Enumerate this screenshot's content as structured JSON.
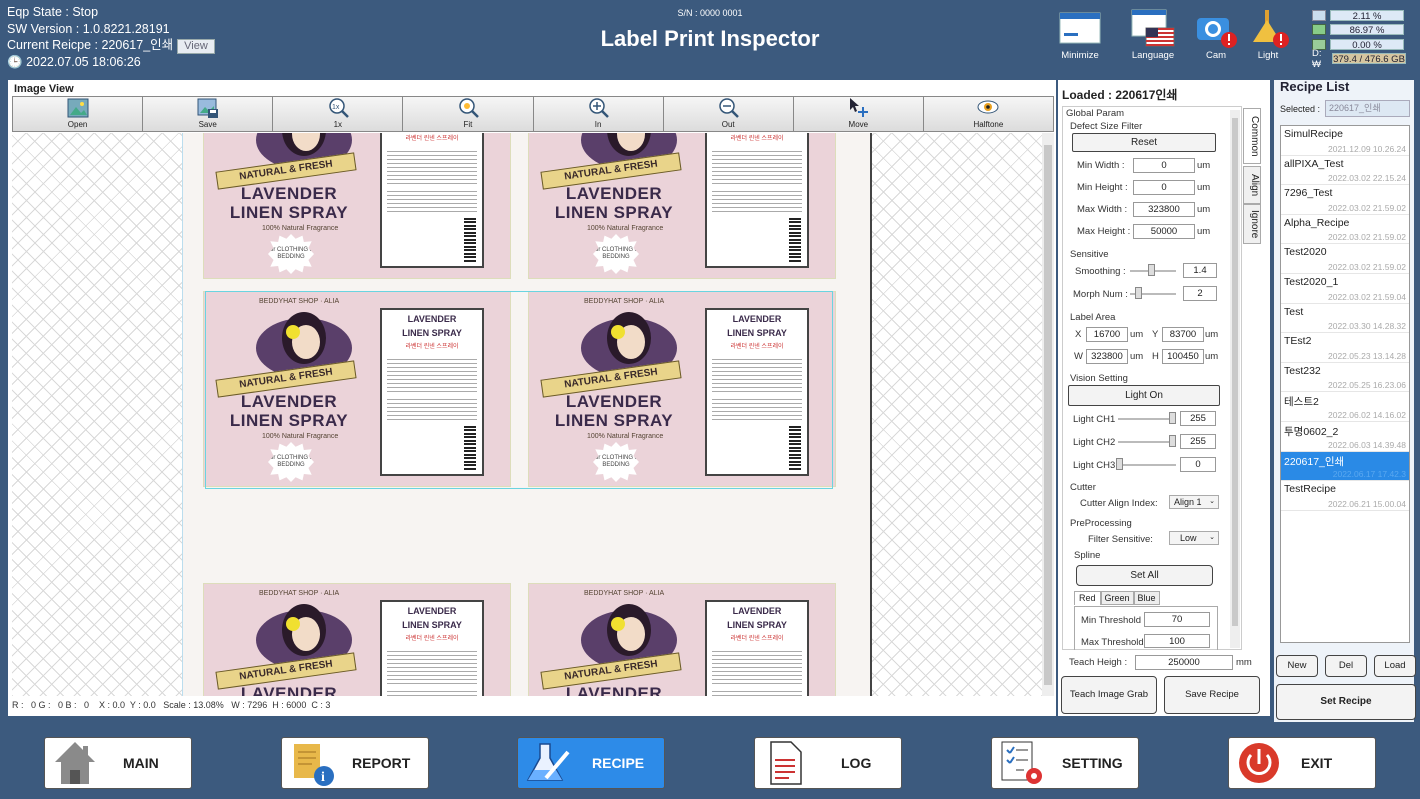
{
  "header": {
    "eqp_state": "Eqp State : Stop",
    "sw_version": "SW Version : 1.0.8221.28191",
    "current_recipe": "Current Reicpe : 220617_인쇄",
    "view_label": "View",
    "datetime": "2022.07.05 18:06:26",
    "serial": "S/N : 0000 0001",
    "title": "Label Print Inspector",
    "icons": {
      "minimize": "Minimize",
      "language": "Language",
      "cam": "Cam",
      "light": "Light"
    },
    "disk": {
      "cpu": "2.11 %",
      "mem": "86.97 %",
      "net": "0.00 %",
      "drive_label": "D:₩",
      "drive": "379.4 / 476.6 GB"
    }
  },
  "image_view": {
    "title": "Image View",
    "tools": [
      "Open",
      "Save",
      "1x",
      "Fit",
      "In",
      "Out",
      "Move",
      "Halftone"
    ],
    "status": "R :   0 G :   0 B :   0    X : 0.0  Y : 0.0   Scale : 13.08%   W : 7296  H : 6000  C : 3",
    "label": {
      "name1": "LAVENDER",
      "name2": "LINEN SPRAY",
      "ribbon": "NATURAL & FRESH",
      "tag": "100% Natural Fragrance",
      "badge": "for CLOTHING & BEDDING",
      "brand": "BEDDYHAT SHOP · ALIA",
      "panel_title1": "LAVENDER",
      "panel_title2": "LINEN SPRAY",
      "panel_sub": "라벤더 린넨 스프레이"
    }
  },
  "params": {
    "loaded": "Loaded : 220617인쇄",
    "global": "Global Param",
    "defect": "Defect Size Filter",
    "reset": "Reset",
    "min_width_l": "Min Width :",
    "min_width": "0",
    "min_height_l": "Min Height :",
    "min_height": "0",
    "max_width_l": "Max Width :",
    "max_width": "323800",
    "max_height_l": "Max Height :",
    "max_height": "50000",
    "um": "um",
    "sensitive": "Sensitive",
    "smoothing_l": "Smoothing :",
    "smoothing": "1.4",
    "morph_l": "Morph Num :",
    "morph": "2",
    "label_area": "Label Area",
    "x_l": "X",
    "x": "16700",
    "y_l": "Y",
    "y": "83700",
    "w_l": "W",
    "w": "323800",
    "h_l": "H",
    "h": "100450",
    "vision": "Vision Setting",
    "light_on": "Light On",
    "ch1_l": "Light CH1",
    "ch1": "255",
    "ch2_l": "Light CH2",
    "ch2": "255",
    "ch3_l": "Light CH3",
    "ch3": "0",
    "cutter": "Cutter",
    "cutter_idx_l": "Cutter Align Index:",
    "cutter_idx": "Align 1",
    "preproc": "PreProcessing",
    "filter_l": "Filter Sensitive:",
    "filter": "Low",
    "spline": "Spline",
    "set_all": "Set All",
    "tabs": [
      "Red",
      "Green",
      "Blue"
    ],
    "min_th_l": "Min Threshold",
    "min_th": "70",
    "max_th_l": "Max Threshold",
    "max_th": "100",
    "teach_l": "Teach Heigh :",
    "teach": "250000",
    "mm": "mm",
    "teach_grab": "Teach Image Grab",
    "save_recipe": "Save Recipe",
    "side_tabs": [
      "Common",
      "Align",
      "Ignore"
    ]
  },
  "recipes": {
    "title": "Recipe List",
    "selected_l": "Selected :",
    "selected": "220617_인쇄",
    "items": [
      {
        "name": "SimulRecipe",
        "date": "2021.12.09 10.26.24"
      },
      {
        "name": "allPIXA_Test",
        "date": "2022.03.02 22.15.24"
      },
      {
        "name": "7296_Test",
        "date": "2022.03.02 21.59.02"
      },
      {
        "name": "Alpha_Recipe",
        "date": "2022.03.02 21.59.02"
      },
      {
        "name": "Test2020",
        "date": "2022.03.02 21.59.02"
      },
      {
        "name": "Test2020_1",
        "date": "2022.03.02 21.59.04"
      },
      {
        "name": "Test",
        "date": "2022.03.30 14.28.32"
      },
      {
        "name": "TEst2",
        "date": "2022.05.23 13.14.28"
      },
      {
        "name": "Test232",
        "date": "2022.05.25 16.23.06"
      },
      {
        "name": "테스트2",
        "date": "2022.06.02 14.16.02"
      },
      {
        "name": "투명0602_2",
        "date": "2022.06.03 14.39.48"
      },
      {
        "name": "220617_인쇄",
        "date": "2022.06.17 17.42.3"
      },
      {
        "name": "TestRecipe",
        "date": "2022.06.21 15.00.04"
      }
    ],
    "new": "New",
    "del": "Del",
    "load": "Load",
    "set_recipe": "Set Recipe"
  },
  "nav": {
    "main": "MAIN",
    "report": "REPORT",
    "recipe": "RECIPE",
    "log": "LOG",
    "setting": "SETTING",
    "exit": "EXIT"
  },
  "colors": {
    "frame": "#3c5a7e",
    "accent": "#2d8be8"
  }
}
